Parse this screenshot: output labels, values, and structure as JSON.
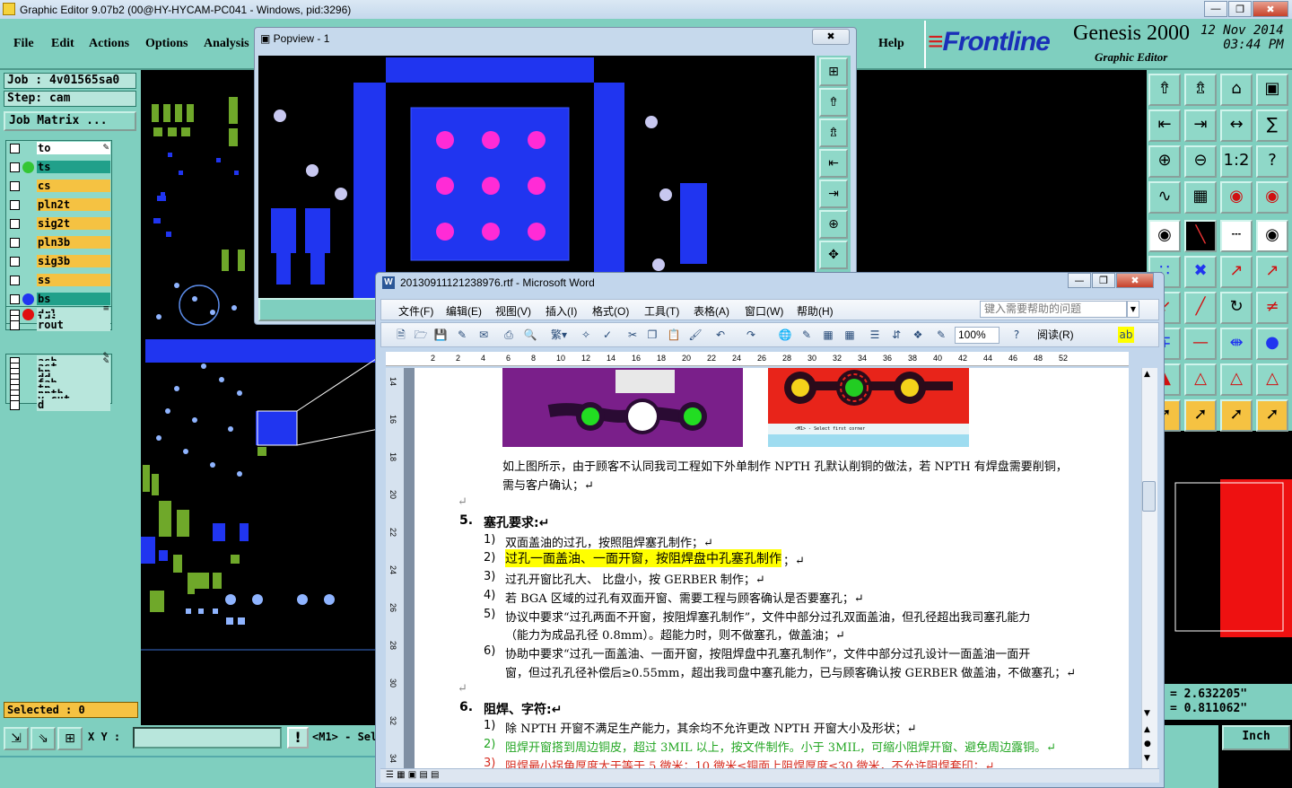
{
  "genesis": {
    "title": "Graphic Editor 9.07b2 (00@HY-HYCAM-PC041 - Windows, pid:3296)",
    "menu": [
      "File",
      "Edit",
      "Actions",
      "Options",
      "Analysis"
    ],
    "help": "Help",
    "brand": "Frontline",
    "product": "Genesis 2000",
    "product_sub": "Graphic Editor",
    "date": "12 Nov 2014",
    "time": "03:44 PM",
    "job": "Job : 4v01565sa0",
    "step": "Step: cam",
    "job_matrix": "Job Matrix ...",
    "layers_group1": [
      {
        "name": "to",
        "bg": "#ffffff",
        "dot": "",
        "tag": "✎"
      },
      {
        "name": "ts",
        "bg": "#21a08a",
        "dot": "#34c634",
        "tag": ""
      },
      {
        "name": "cs",
        "bg": "#f5c242",
        "dot": "",
        "tag": ""
      },
      {
        "name": "pln2t",
        "bg": "#f5c242",
        "dot": "",
        "tag": ""
      },
      {
        "name": "sig2t",
        "bg": "#f5c242",
        "dot": "",
        "tag": ""
      },
      {
        "name": "pln3b",
        "bg": "#f5c242",
        "dot": "",
        "tag": ""
      },
      {
        "name": "sig3b",
        "bg": "#f5c242",
        "dot": "",
        "tag": ""
      },
      {
        "name": "ss",
        "bg": "#f5c242",
        "dot": "",
        "tag": ""
      },
      {
        "name": "bs",
        "bg": "#21a08a",
        "dot": "#2035f0",
        "tag": ""
      },
      {
        "name": "bo",
        "bg": "#ffffff",
        "dot": "",
        "tag": "✎"
      }
    ],
    "layers_group2": [
      {
        "name": "drl",
        "bg": "#b8e6dc",
        "dot": "#e01010",
        "tag": "≡"
      },
      {
        "name": "ldi",
        "bg": "#b8e6dc",
        "dot": "",
        "tag": ""
      },
      {
        "name": "rout",
        "bg": "#b8e6dc",
        "dot": "",
        "tag": ""
      }
    ],
    "layers_group3": [
      {
        "name": "asb",
        "bg": "#b8e6dc",
        "dot": "",
        "tag": "✎"
      },
      {
        "name": "ast",
        "bg": "#b8e6dc",
        "dot": "",
        "tag": "✎"
      },
      {
        "name": "bp",
        "bg": "#b8e6dc",
        "dot": "",
        "tag": ""
      },
      {
        "name": "dd",
        "bg": "#b8e6dc",
        "dot": "",
        "tag": ""
      },
      {
        "name": "fab",
        "bg": "#b8e6dc",
        "dot": "",
        "tag": ""
      },
      {
        "name": "tp",
        "bg": "#b8e6dc",
        "dot": "",
        "tag": ""
      },
      {
        "name": "npth",
        "bg": "#b8e6dc",
        "dot": "",
        "tag": ""
      },
      {
        "name": "v-cut",
        "bg": "#b8e6dc",
        "dot": "",
        "tag": ""
      },
      {
        "name": "d",
        "bg": "#b8e6dc",
        "dot": "",
        "tag": ""
      }
    ],
    "selected": "Selected : 0",
    "xy_label": "X Y :",
    "message": "<M1> - Sel",
    "coord_x": "= 2.632205\"",
    "coord_y": "= 0.811062\"",
    "units": "Inch"
  },
  "popview": {
    "title": "Popview - 1",
    "close": "✖"
  },
  "word": {
    "title": "20130911121238976.rtf - Microsoft Word",
    "icon": "W",
    "menu": [
      "文件(F)",
      "编辑(E)",
      "视图(V)",
      "插入(I)",
      "格式(O)",
      "工具(T)",
      "表格(A)",
      "窗口(W)",
      "帮助(H)"
    ],
    "help_placeholder": "键入需要帮助的问题",
    "zoom": "100%",
    "read": "阅读(R)",
    "ruler_marks": [
      "2",
      "2",
      "4",
      "6",
      "8",
      "10",
      "12",
      "14",
      "16",
      "18",
      "20",
      "22",
      "24",
      "26",
      "28",
      "30",
      "32",
      "34",
      "36",
      "38",
      "40",
      "42",
      "44",
      "46",
      "48",
      "52"
    ],
    "vruler_marks": [
      "14",
      "16",
      "18",
      "20",
      "22",
      "24",
      "26",
      "28",
      "30",
      "32",
      "34"
    ],
    "para_intro": [
      "如上图所示，由于顾客不认同我司工程如下外单制作 NPTH 孔默认削铜的做法，若 NPTH 有焊盘需要削铜，",
      "需与客户确认；↵"
    ],
    "sec5_num": "5.",
    "sec5_title": "塞孔要求:↵",
    "sec5_items": [
      {
        "n": "1)",
        "t": "双面盖油的过孔，按照阻焊塞孔制作；↵"
      },
      {
        "n": "2)",
        "t": "过孔一面盖油、一面开窗，按阻焊盘中孔塞孔制作",
        "t2": "；↵"
      },
      {
        "n": "3)",
        "t": "过孔开窗比孔大、 比盘小，按 GERBER 制作；↵"
      },
      {
        "n": "4)",
        "t": "若 BGA 区域的过孔有双面开窗、需要工程与顾客确认是否要塞孔；↵"
      },
      {
        "n": "5)",
        "t": "协议中要求“过孔两面不开窗，按阻焊塞孔制作”，文件中部分过孔双面盖油，但孔径超出我司塞孔能力",
        "t2": "（能力为成品孔径 0.8mm）。超能力时，则不做塞孔，做盖油；↵"
      },
      {
        "n": "6)",
        "t": "协助中要求“过孔一面盖油、一面开窗，按阻焊盘中孔塞孔制作”，文件中部分过孔设计一面盖油一面开",
        "t2": "窗，但过孔孔径补偿后≥0.55mm，超出我司盘中塞孔能力，已与顾客确认按 GERBER 做盖油，不做塞孔；↵"
      }
    ],
    "sec6_num": "6.",
    "sec6_title": "阻焊、字符:↵",
    "sec6_items": [
      {
        "n": "1)",
        "t": "除 NPTH 开窗不满足生产能力，其余均不允许更改 NPTH 开窗大小及形状；↵"
      },
      {
        "n": "2)",
        "t": "阻焊开窗搭到周边铜皮，超过 3MIL 以上，按文件制作。小于 3MIL，可缩小阻焊开窗、避免周边露铜。↵"
      },
      {
        "n": "3)",
        "t": "阻焊最小拐角厚度大于等于 5 微米；10 微米≤铜面上阻焊厚度≤30 微米，不允许阻焊套印；↵"
      }
    ],
    "small_caption": "<M1> - Select first corner"
  }
}
